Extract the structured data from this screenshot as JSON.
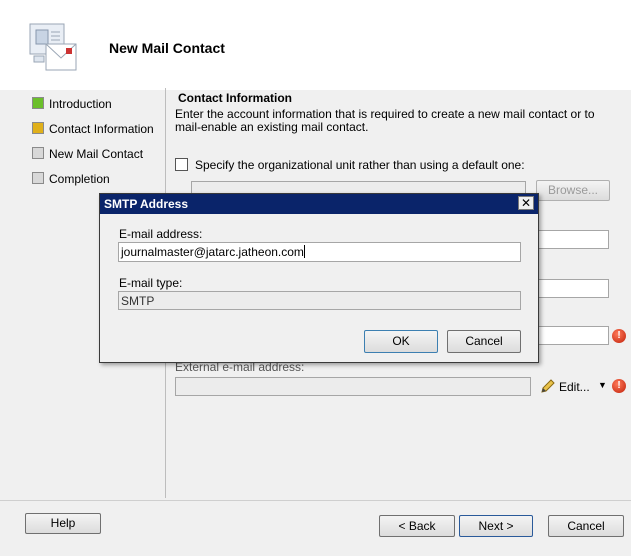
{
  "header": {
    "title": "New Mail Contact",
    "icon": "mail-contact-icon"
  },
  "nav": {
    "items": [
      {
        "label": "Introduction",
        "state": "complete",
        "color": "#6bbf2a"
      },
      {
        "label": "Contact Information",
        "state": "current",
        "color": "#e0b01a"
      },
      {
        "label": "New Mail Contact",
        "state": "pending",
        "color": "#d8d8d8"
      },
      {
        "label": "Completion",
        "state": "pending",
        "color": "#d8d8d8"
      }
    ]
  },
  "main": {
    "section_title": "Contact Information",
    "description": "Enter the account information that is required to create a new mail contact or to mail-enable an existing mail contact.",
    "ou_checkbox_label": "Specify the organizational unit rather than using a default one:",
    "ou_checked": false,
    "browse_label": "Browse...",
    "external_email_label": "External e-mail address:",
    "edit_label": "Edit...",
    "error_icon": "error-icon"
  },
  "dialog": {
    "title": "SMTP Address",
    "close_glyph": "✕",
    "email_label": "E-mail address:",
    "email_value": "journalmaster@jatarc.jatheon.com",
    "type_label": "E-mail type:",
    "type_value": "SMTP",
    "ok_label": "OK",
    "cancel_label": "Cancel"
  },
  "footer": {
    "help_label": "Help",
    "back_label": "< Back",
    "next_label": "Next >",
    "cancel_label": "Cancel"
  },
  "colors": {
    "titlebar": "#0a246a",
    "error": "#d0280e"
  }
}
